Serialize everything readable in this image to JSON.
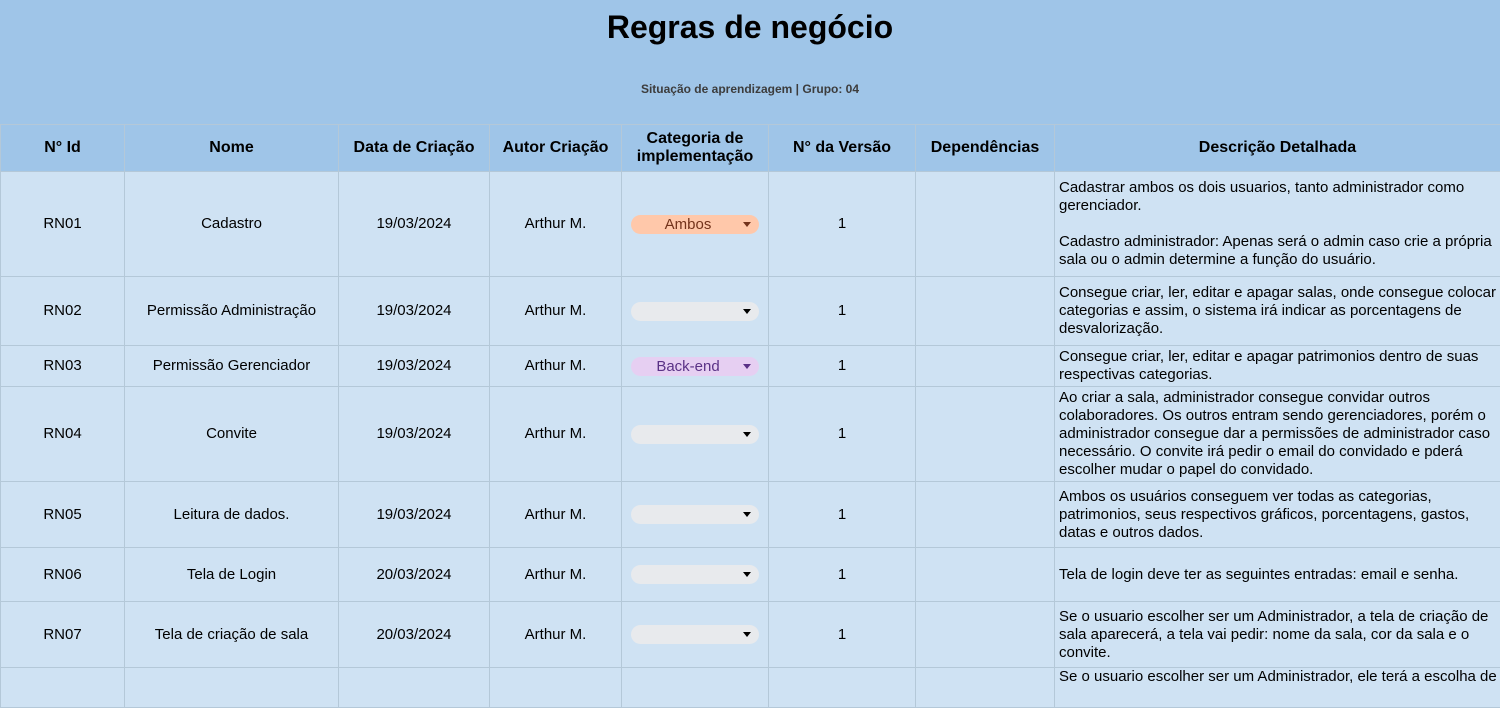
{
  "header": {
    "title": "Regras de negócio",
    "subtitle": "Situação de aprendizagem | Grupo: 04"
  },
  "columns": {
    "id": "N° Id",
    "nome": "Nome",
    "data": "Data de Criação",
    "autor": "Autor Criação",
    "categoria_l1": "Categoria de",
    "categoria_l2": "implementação",
    "versao": "N° da Versão",
    "dependencias": "Dependências",
    "descricao": "Descrição Detalhada"
  },
  "category_colors": {
    "Ambos": "#ffc8aa",
    "Back-end": "#e6cff2",
    "empty": "#e8eaed"
  },
  "rows": [
    {
      "id": "RN01",
      "nome": "Cadastro",
      "data": "19/03/2024",
      "autor": "Arthur M.",
      "categoria": "Ambos",
      "versao": "1",
      "dependencias": "",
      "descricao": "Cadastrar ambos os dois usuarios, tanto administrador como gerenciador.\n\nCadastro administrador: Apenas será o admin caso crie a própria sala ou o admin determine a função do usuário."
    },
    {
      "id": "RN02",
      "nome": "Permissão Administração",
      "data": "19/03/2024",
      "autor": "Arthur M.",
      "categoria": "",
      "versao": "1",
      "dependencias": "",
      "descricao": "Consegue criar, ler, editar e apagar salas, onde consegue colocar categorias e assim, o sistema irá indicar as porcentagens de desvalorização."
    },
    {
      "id": "RN03",
      "nome": "Permissão Gerenciador",
      "data": "19/03/2024",
      "autor": "Arthur M.",
      "categoria": "Back-end",
      "versao": "1",
      "dependencias": "",
      "descricao": "Consegue criar, ler, editar e apagar patrimonios dentro de suas respectivas categorias."
    },
    {
      "id": "RN04",
      "nome": "Convite",
      "data": "19/03/2024",
      "autor": "Arthur M.",
      "categoria": "",
      "versao": "1",
      "dependencias": "",
      "descricao": "Ao criar a sala, administrador consegue convidar outros colaboradores. Os outros entram sendo gerenciadores, porém o administrador consegue dar a permissões de administrador caso necessário. O convite irá pedir o email do convidado e pderá escolher mudar o papel do convidado."
    },
    {
      "id": "RN05",
      "nome": "Leitura de dados.",
      "data": "19/03/2024",
      "autor": "Arthur M.",
      "categoria": "",
      "versao": "1",
      "dependencias": "",
      "descricao": "Ambos os usuários conseguem ver todas as categorias, patrimonios, seus respectivos gráficos, porcentagens, gastos, datas e outros dados."
    },
    {
      "id": "RN06",
      "nome": "Tela de Login",
      "data": "20/03/2024",
      "autor": "Arthur M.",
      "categoria": "",
      "versao": "1",
      "dependencias": "",
      "descricao": "Tela de login deve ter as seguintes entradas: email e senha."
    },
    {
      "id": "RN07",
      "nome": "Tela de criação de sala",
      "data": "20/03/2024",
      "autor": "Arthur M.",
      "categoria": "",
      "versao": "1",
      "dependencias": "",
      "descricao": "Se o usuario escolher ser um Administrador, a tela de criação de sala aparecerá, a tela vai pedir: nome da sala, cor da sala e o convite."
    },
    {
      "id": "",
      "nome": "",
      "data": "",
      "autor": "",
      "categoria": "",
      "versao": "",
      "dependencias": "",
      "descricao": "Se o usuario escolher ser um Administrador, ele terá a escolha de"
    }
  ]
}
